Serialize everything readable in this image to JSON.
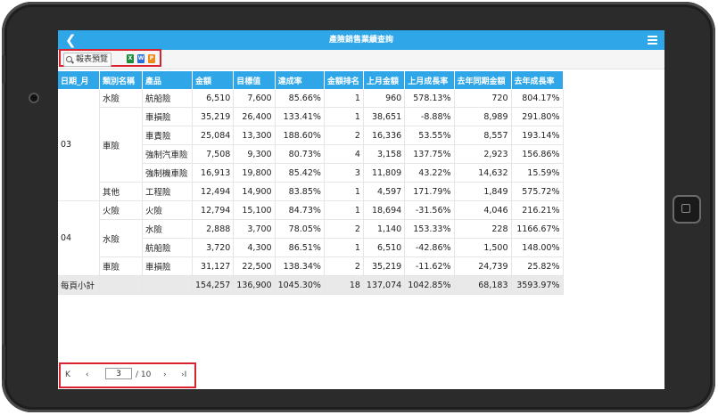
{
  "header": {
    "title": "產險銷售業績查詢"
  },
  "toolbar": {
    "preview_label": "報表預覽",
    "export_icons": [
      "excel-icon",
      "word-icon",
      "pdf-icon"
    ]
  },
  "table": {
    "columns": [
      "日期_月",
      "類別名稱",
      "產品",
      "金額",
      "目標值",
      "達成率",
      "金額排名",
      "上月金額",
      "上月成長率",
      "去年同期金額",
      "去年成長率"
    ],
    "rows": [
      {
        "month": "03",
        "category": "水險",
        "product": "航船險",
        "amount": "6,510",
        "target": "7,600",
        "achieve": "85.66%",
        "rank": "1",
        "last_month": "960",
        "mom": "578.13%",
        "last_year": "720",
        "yoy": "804.17%"
      },
      {
        "month": "",
        "category": "車險",
        "product": "車損險",
        "amount": "35,219",
        "target": "26,400",
        "achieve": "133.41%",
        "rank": "1",
        "last_month": "38,651",
        "mom": "-8.88%",
        "last_year": "8,989",
        "yoy": "291.80%"
      },
      {
        "month": "",
        "category": "",
        "product": "車責險",
        "amount": "25,084",
        "target": "13,300",
        "achieve": "188.60%",
        "rank": "2",
        "last_month": "16,336",
        "mom": "53.55%",
        "last_year": "8,557",
        "yoy": "193.14%"
      },
      {
        "month": "",
        "category": "",
        "product": "強制汽車險",
        "amount": "7,508",
        "target": "9,300",
        "achieve": "80.73%",
        "rank": "4",
        "last_month": "3,158",
        "mom": "137.75%",
        "last_year": "2,923",
        "yoy": "156.86%"
      },
      {
        "month": "",
        "category": "",
        "product": "強制機車險",
        "amount": "16,913",
        "target": "19,800",
        "achieve": "85.42%",
        "rank": "3",
        "last_month": "11,809",
        "mom": "43.22%",
        "last_year": "14,632",
        "yoy": "15.59%"
      },
      {
        "month": "",
        "category": "其他",
        "product": "工程險",
        "amount": "12,494",
        "target": "14,900",
        "achieve": "83.85%",
        "rank": "1",
        "last_month": "4,597",
        "mom": "171.79%",
        "last_year": "1,849",
        "yoy": "575.72%"
      },
      {
        "month": "04",
        "category": "火險",
        "product": "火險",
        "amount": "12,794",
        "target": "15,100",
        "achieve": "84.73%",
        "rank": "1",
        "last_month": "18,694",
        "mom": "-31.56%",
        "last_year": "4,046",
        "yoy": "216.21%"
      },
      {
        "month": "",
        "category": "水險",
        "product": "水險",
        "amount": "2,888",
        "target": "3,700",
        "achieve": "78.05%",
        "rank": "2",
        "last_month": "1,140",
        "mom": "153.33%",
        "last_year": "228",
        "yoy": "1166.67%"
      },
      {
        "month": "",
        "category": "",
        "product": "航船險",
        "amount": "3,720",
        "target": "4,300",
        "achieve": "86.51%",
        "rank": "1",
        "last_month": "6,510",
        "mom": "-42.86%",
        "last_year": "1,500",
        "yoy": "148.00%"
      },
      {
        "month": "",
        "category": "車險",
        "product": "車損險",
        "amount": "31,127",
        "target": "22,500",
        "achieve": "138.34%",
        "rank": "2",
        "last_month": "35,219",
        "mom": "-11.62%",
        "last_year": "24,739",
        "yoy": "25.82%"
      }
    ],
    "subtotal": {
      "label": "每頁小計",
      "amount": "154,257",
      "target": "136,900",
      "achieve": "1045.30%",
      "rank": "18",
      "last_month": "137,074",
      "mom": "1042.85%",
      "last_year": "68,183",
      "yoy": "3593.97%"
    }
  },
  "pager": {
    "current_page": "3",
    "total_label": "/ 10",
    "first": "K",
    "prev": "‹",
    "next": "›",
    "last": "›I"
  },
  "icons": {
    "back": "back-icon",
    "menu": "menu-icon"
  }
}
